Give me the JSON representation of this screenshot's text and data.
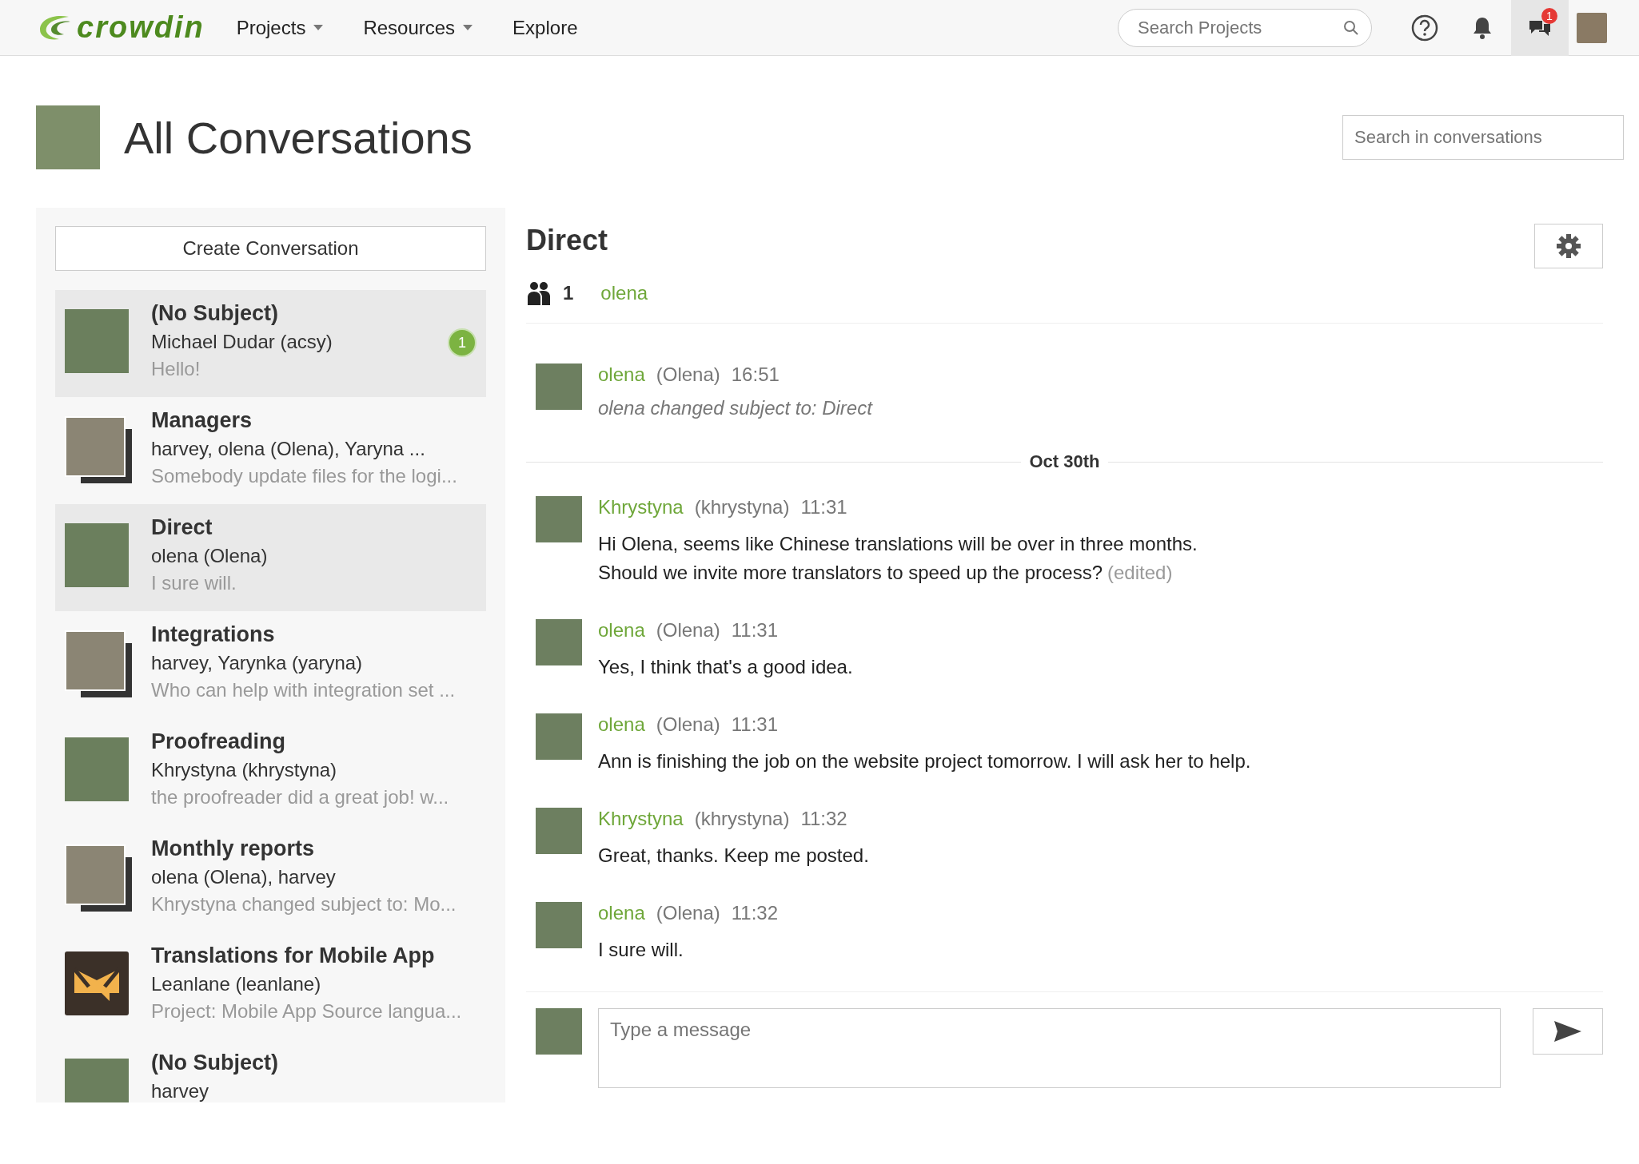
{
  "navbar": {
    "logo": "crowdin",
    "menu": [
      {
        "label": "Projects",
        "dropdown": true
      },
      {
        "label": "Resources",
        "dropdown": true
      },
      {
        "label": "Explore",
        "dropdown": false
      }
    ],
    "search": {
      "placeholder": "Search Projects"
    },
    "messages_badge": "1"
  },
  "page": {
    "title": "All Conversations",
    "search": {
      "placeholder": "Search in conversations"
    }
  },
  "sidebar": {
    "create_button": "Create Conversation",
    "conversations": [
      {
        "subject": "(No Subject)",
        "members": "Michael Dudar (acsy)",
        "preview": "Hello!",
        "kind": "single",
        "selected": true,
        "unread": "1"
      },
      {
        "subject": "Managers",
        "members": "harvey, olena (Olena), Yaryna ...",
        "preview": "Somebody update files for the logi...",
        "kind": "group",
        "selected": false
      },
      {
        "subject": "Direct",
        "members": "olena (Olena)",
        "preview": "I sure will.",
        "kind": "single",
        "selected": true
      },
      {
        "subject": "Integrations",
        "members": "harvey, Yarynka (yaryna)",
        "preview": "Who can help with integration set ...",
        "kind": "group",
        "selected": false
      },
      {
        "subject": "Proofreading",
        "members": "Khrystyna (khrystyna)",
        "preview": "the proofreader did a great job! w...",
        "kind": "single",
        "selected": false
      },
      {
        "subject": "Monthly reports",
        "members": "olena (Olena), harvey",
        "preview": "Khrystyna changed subject to: Mo...",
        "kind": "group",
        "selected": false
      },
      {
        "subject": "Translations for Mobile App",
        "members": "Leanlane (leanlane)",
        "preview": "Project: Mobile App Source langua...",
        "kind": "logo",
        "selected": false
      },
      {
        "subject": "(No Subject)",
        "members": "harvey",
        "kind": "single",
        "selected": false
      }
    ]
  },
  "conversation": {
    "title": "Direct",
    "participant_count": "1",
    "participants": [
      "olena"
    ],
    "messages": [
      {
        "kind": "system",
        "author": "olena",
        "full_name": "(Olena)",
        "time": "16:51",
        "text": "olena changed subject to: Direct"
      },
      {
        "kind": "date",
        "text": "Oct 30th"
      },
      {
        "kind": "message",
        "author": "Khrystyna",
        "full_name": "(khrystyna)",
        "time": "11:31",
        "lines": [
          "Hi Olena, seems like Chinese translations will be over in three months.",
          "Should we invite more translators to speed up the process?"
        ],
        "edited": "(edited)"
      },
      {
        "kind": "message",
        "author": "olena",
        "full_name": "(Olena)",
        "time": "11:31",
        "lines": [
          "Yes, I think that's a good idea."
        ]
      },
      {
        "kind": "message",
        "author": "olena",
        "full_name": "(Olena)",
        "time": "11:31",
        "lines": [
          "Ann is finishing the job on the website project tomorrow. I will ask her to help."
        ]
      },
      {
        "kind": "message",
        "author": "Khrystyna",
        "full_name": "(khrystyna)",
        "time": "11:32",
        "lines": [
          "Great, thanks. Keep me posted."
        ]
      },
      {
        "kind": "message",
        "author": "olena",
        "full_name": "(Olena)",
        "time": "11:32",
        "lines": [
          "I sure will."
        ]
      }
    ],
    "composer": {
      "placeholder": "Type a message"
    }
  }
}
